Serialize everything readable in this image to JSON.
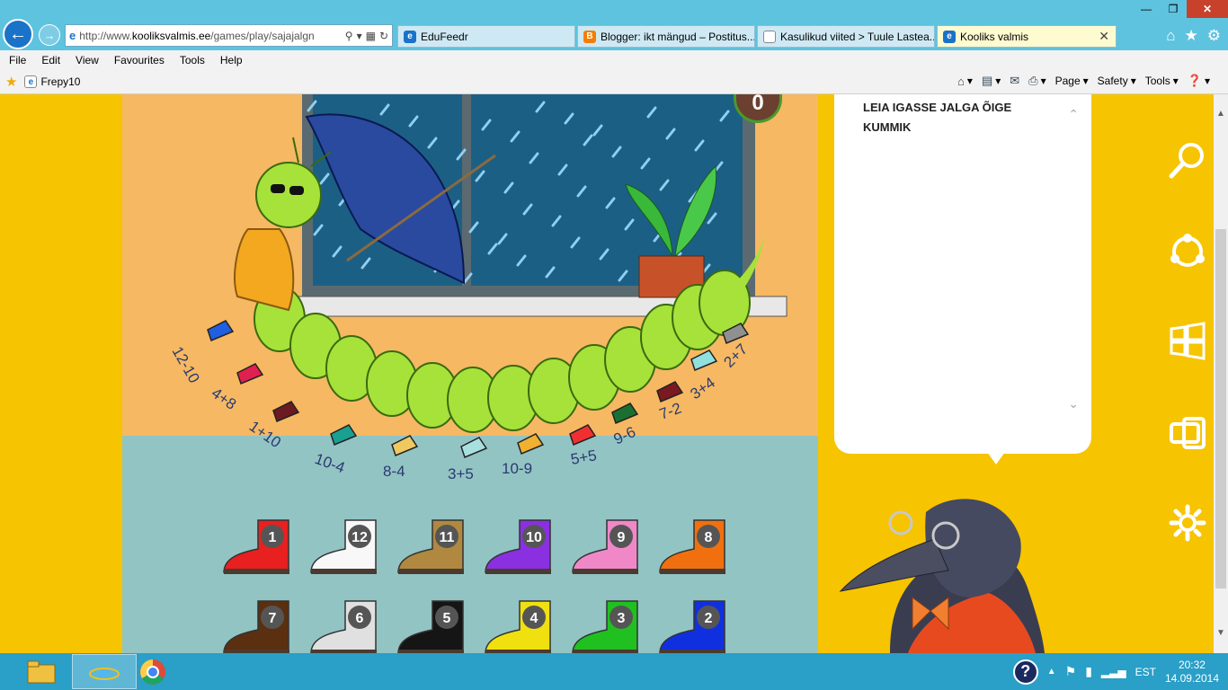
{
  "browser": {
    "url_prefix": "http://www.",
    "url_domain": "kooliksvalmis.ee",
    "url_path": "/games/play/sajajalgn",
    "tabs": [
      {
        "label": "EduFeedr",
        "icon_color": "#1a73c8"
      },
      {
        "label": "Blogger: ikt mängud – Postitus...",
        "icon_color": "#f57d00"
      },
      {
        "label": "Kasulikud viited > Tuule Lastea...",
        "icon_color": "#ffffff"
      },
      {
        "label": "Kooliks valmis",
        "icon_color": "#1a73c8"
      }
    ],
    "menu": [
      "File",
      "Edit",
      "View",
      "Favourites",
      "Tools",
      "Help"
    ],
    "favourite": "Frepy10",
    "commands": [
      "Page",
      "Safety",
      "Tools"
    ]
  },
  "game": {
    "score": "0",
    "instruction": "LEIA IGASSE JALGA ÕIGE KUMMIK",
    "sky_color": "#1c5f85",
    "caterpillar_color": "#a6e23a",
    "leg_labels": [
      "12-10",
      "4+8",
      "1+10",
      "10-4",
      "8-4",
      "3+5",
      "10-9",
      "5+5",
      "9-6",
      "7-2",
      "3+4",
      "2+7"
    ],
    "leg_sock_colors": [
      "#1f5fe0",
      "#e02050",
      "#6a1a20",
      "#1aa090",
      "#f0c860",
      "#a8e0e0",
      "#f0b030",
      "#f03030",
      "#1a7030",
      "#7a1a20",
      "#90e0e0",
      "#909090"
    ],
    "boots": [
      {
        "number": "1",
        "color": "#e82020"
      },
      {
        "number": "12",
        "color": "#f8f8f8"
      },
      {
        "number": "11",
        "color": "#b08840"
      },
      {
        "number": "10",
        "color": "#8a30e0"
      },
      {
        "number": "9",
        "color": "#f088c8"
      },
      {
        "number": "8",
        "color": "#f07010"
      },
      {
        "number": "7",
        "color": "#5a3010"
      },
      {
        "number": "6",
        "color": "#e0e0e0"
      },
      {
        "number": "5",
        "color": "#151515"
      },
      {
        "number": "4",
        "color": "#f0e010"
      },
      {
        "number": "3",
        "color": "#20c020"
      },
      {
        "number": "2",
        "color": "#1030e0"
      }
    ]
  },
  "charms": [
    "search-icon",
    "share-icon",
    "start-icon",
    "devices-icon",
    "settings-icon"
  ],
  "taskbar": {
    "language": "EST",
    "time": "20:32",
    "date": "14.09.2014"
  }
}
